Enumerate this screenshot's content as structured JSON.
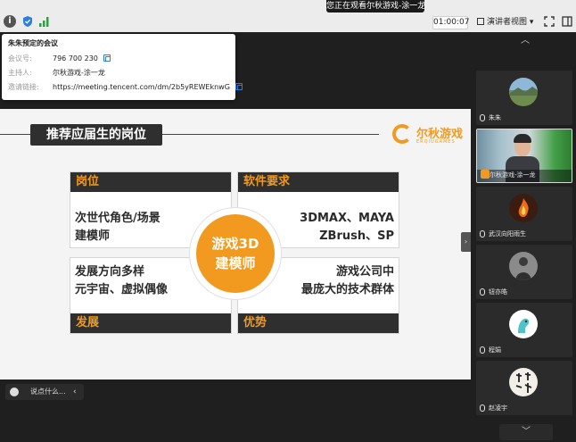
{
  "topbar": {
    "viewing_banner": "您正在观看尔秋游戏-涂一龙的屏幕",
    "timer": "01:00:07",
    "view_mode_label": "演讲者视图",
    "view_mode_arrow": "▾"
  },
  "meeting_info": {
    "title": "朱朱预定的会议",
    "meeting_id_label": "会议号:",
    "meeting_id": "796 700 230",
    "host_label": "主持人:",
    "host": "尔秋游戏-涂一龙",
    "link_label": "邀请链接:",
    "link": "https://meeting.tencent.com/dm/2b5yREWEknwG"
  },
  "slide": {
    "title": "推荐应届生的岗位",
    "logo_name": "尔秋游戏",
    "logo_sub": "ERQIUGAMES",
    "quadrants": {
      "top_left": {
        "header": "岗位",
        "lines": [
          "次世代角色/场景",
          "建模师"
        ]
      },
      "top_right": {
        "header": "软件要求",
        "lines": [
          "3DMAX、MAYA",
          "ZBrush、SP"
        ]
      },
      "bottom_left": {
        "header": "发展",
        "lines": [
          "发展方向多样",
          "元宇宙、虚拟偶像"
        ]
      },
      "bottom_right": {
        "header": "优势",
        "lines": [
          "游戏公司中",
          "最庞大的技术群体"
        ]
      }
    },
    "center_lines": [
      "游戏3D",
      "建模师"
    ]
  },
  "chat": {
    "placeholder": "说点什么...",
    "collapse_arrow": "‹"
  },
  "panel": {
    "up_arrow": "︿",
    "down_arrow": "﹀",
    "collapse_arrow": "›",
    "participants": [
      {
        "name": "朱朱"
      },
      {
        "name": "尔秋游戏-涂一龙"
      },
      {
        "name": "武汉向阳雨生"
      },
      {
        "name": "钮亦皓"
      },
      {
        "name": "程娟"
      },
      {
        "name": "赵凌宇"
      }
    ]
  },
  "colors": {
    "accent_orange": "#f29a1f",
    "slide_dark": "#2f2f2f",
    "panel_bg": "#1f1f1f"
  }
}
